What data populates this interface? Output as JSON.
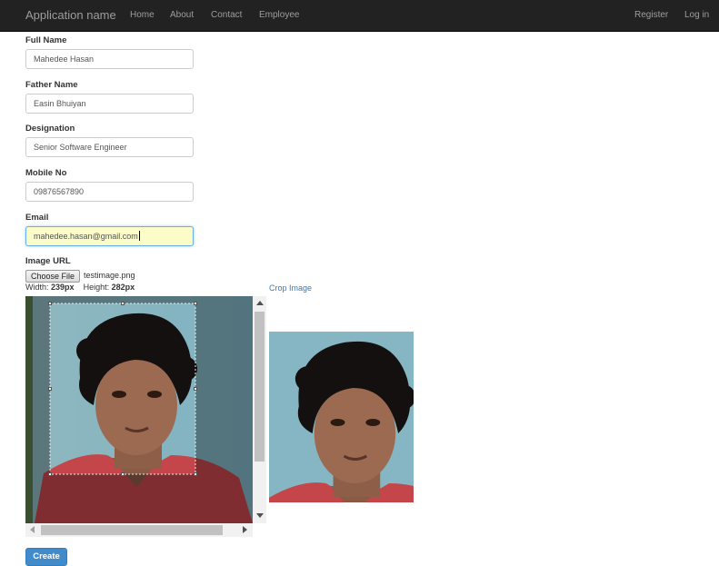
{
  "nav": {
    "brand": "Application name",
    "links": [
      "Home",
      "About",
      "Contact",
      "Employee"
    ],
    "right_links": [
      "Register",
      "Log in"
    ]
  },
  "form": {
    "fields": [
      {
        "label": "Full Name",
        "value": "Mahedee Hasan"
      },
      {
        "label": "Father Name",
        "value": "Easin Bhuiyan"
      },
      {
        "label": "Designation",
        "value": "Senior Software Engineer"
      },
      {
        "label": "Mobile No",
        "value": "09876567890"
      },
      {
        "label": "Email",
        "value": "mahedee.hasan@gmail.com"
      }
    ],
    "image_label": "Image URL",
    "choose_file_label": "Choose File",
    "file_name": "testimage.png",
    "width_label": "Width:",
    "width_value": "239px",
    "height_label": "Height:",
    "height_value": "282px",
    "crop_link": "Crop Image",
    "create_label": "Create"
  },
  "colors": {
    "navbar": "#222222",
    "link": "#337ab7",
    "primary_button": "#428bca",
    "focused_input": "#fbfcc7"
  }
}
